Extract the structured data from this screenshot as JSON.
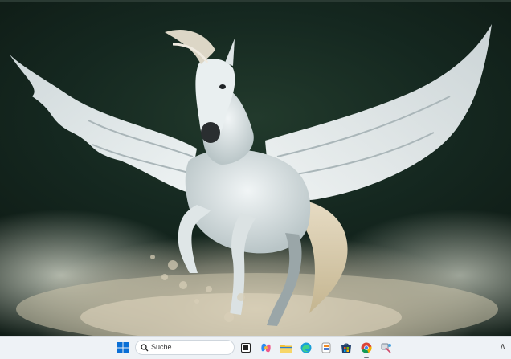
{
  "wallpaper": {
    "subject": "white-winged-horse",
    "colors": {
      "forest": "#152820",
      "dust": "#d6cdb8",
      "horse": "#e6ecee"
    }
  },
  "taskbar": {
    "search_placeholder": "Suche",
    "icons": [
      {
        "name": "start-icon",
        "color": "#0a6fd6"
      },
      {
        "name": "search-icon"
      },
      {
        "name": "task-view-icon"
      },
      {
        "name": "copilot-icon"
      },
      {
        "name": "file-explorer-icon",
        "color": "#f2c23a"
      },
      {
        "name": "edge-icon",
        "color": "#1a9fd8"
      },
      {
        "name": "paint-icon"
      },
      {
        "name": "store-icon"
      },
      {
        "name": "chrome-icon"
      },
      {
        "name": "app-icon"
      },
      {
        "name": "chevron-up-icon"
      }
    ]
  }
}
